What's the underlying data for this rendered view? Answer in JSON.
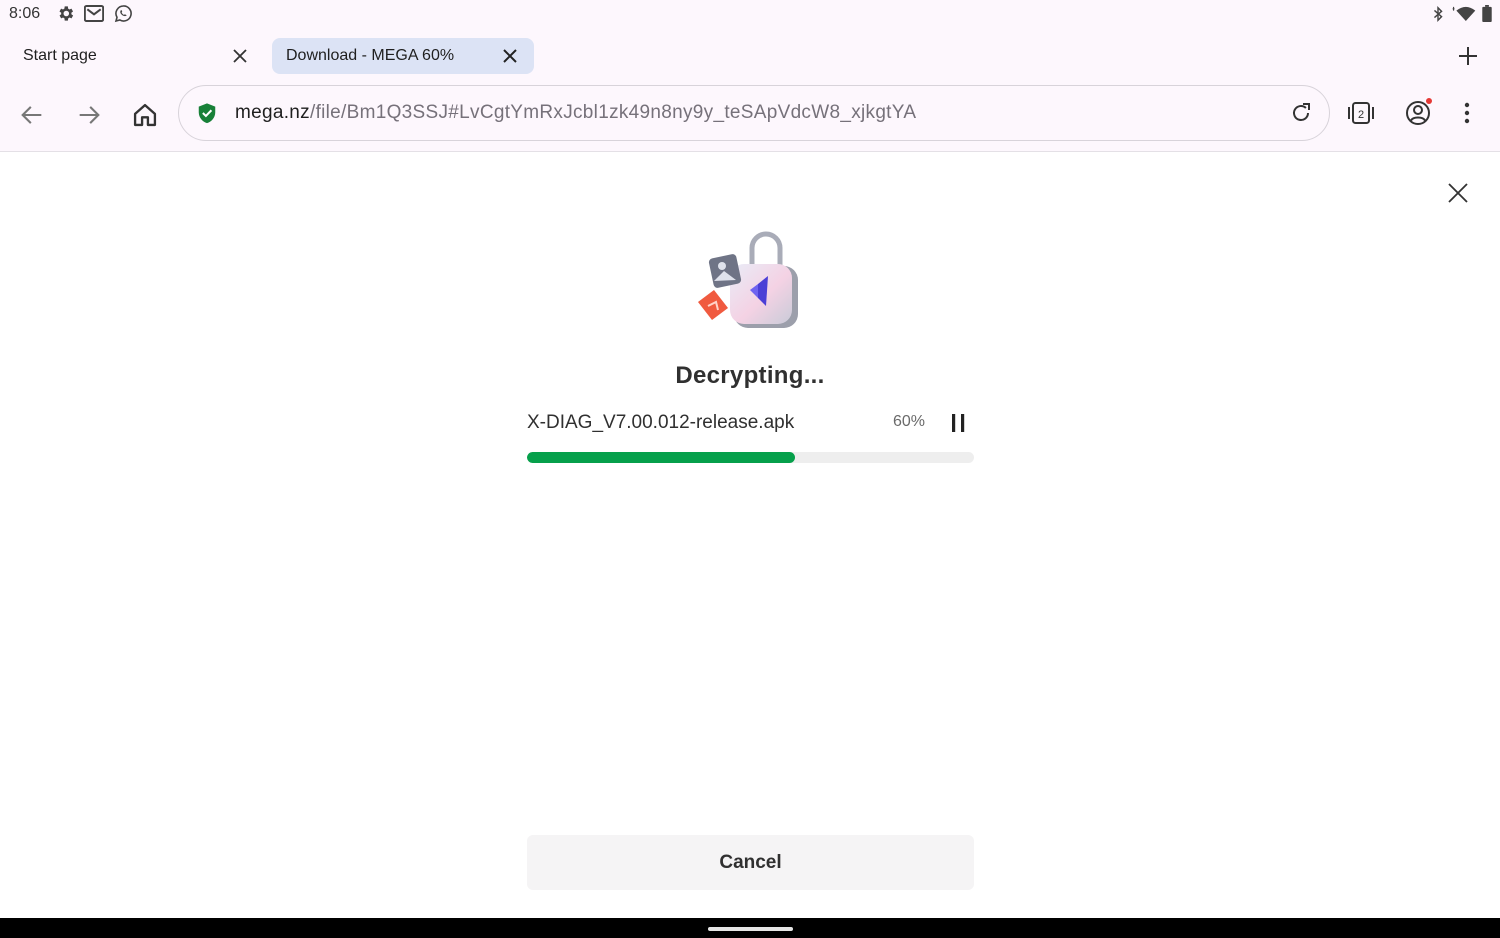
{
  "status_bar": {
    "time": "8:06",
    "left_icons": [
      "gear-icon",
      "gmail-icon",
      "whatsapp-icon"
    ],
    "right_icons": [
      "bluetooth-icon",
      "wifi-icon",
      "battery-icon"
    ]
  },
  "tabs": [
    {
      "label": "Start page",
      "active": false
    },
    {
      "label": "Download - MEGA 60%",
      "active": true
    }
  ],
  "toolbar": {
    "url_host": "mega.nz",
    "url_path": "/file/Bm1Q3SSJ#LvCgtYmRxJcbl1zk49n8ny9y_teSApVdcW8_xjkgtYA",
    "tab_count": "2"
  },
  "dialog": {
    "title": "Decrypting...",
    "file_name": "X-DIAG_V7.00.012-release.apk",
    "percent_label": "60%",
    "progress": 0.6,
    "cancel_label": "Cancel"
  },
  "colors": {
    "accent_green": "#06a04b",
    "active_tab": "#dce3f5",
    "shield_green": "#188038"
  }
}
